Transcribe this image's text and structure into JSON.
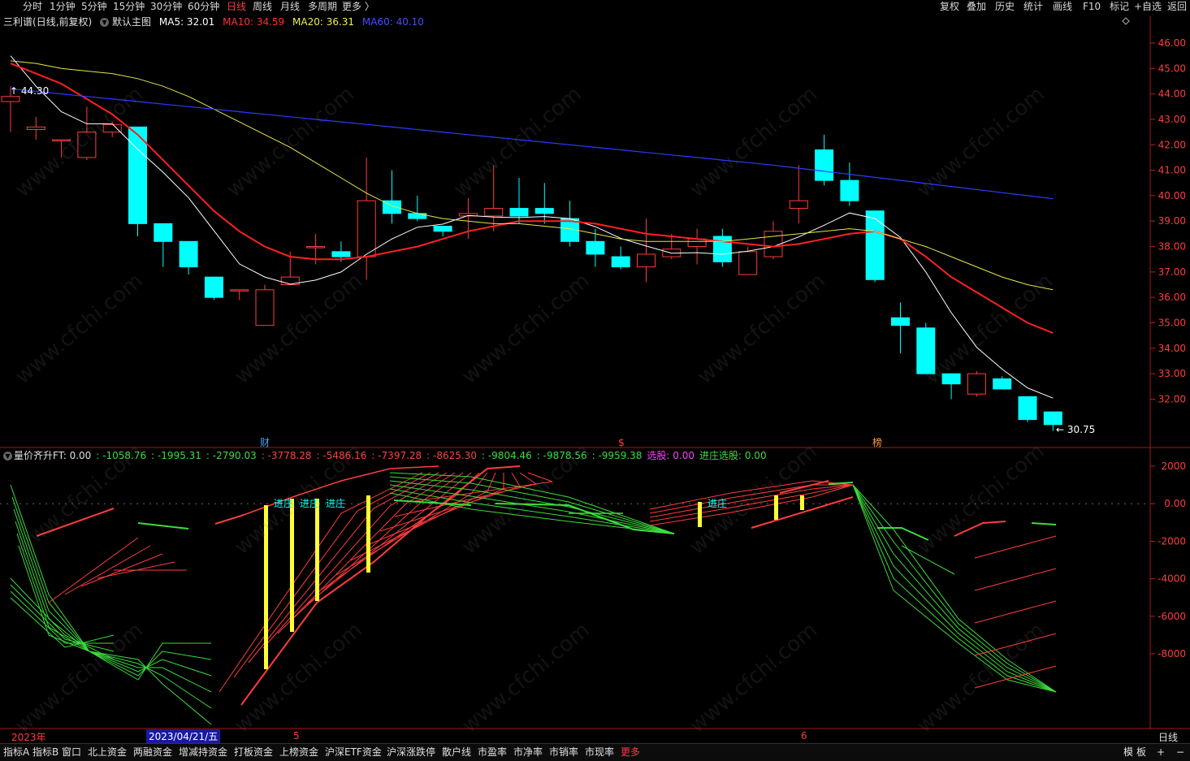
{
  "top_bar": {
    "timeframes": [
      "分时",
      "1分钟",
      "5分钟",
      "15分钟",
      "30分钟",
      "60分钟",
      "日线",
      "周线",
      "月线",
      "多周期",
      "更多 〉"
    ],
    "active_timeframe": "日线",
    "right_buttons": [
      "复权",
      "叠加",
      "历史",
      "统计",
      "画线",
      "F10",
      "标记",
      "+自选",
      "返回"
    ]
  },
  "main_chart": {
    "stock_name": "三利谱",
    "mode": "(日线,前复权)",
    "template": "默认主图",
    "ma5": "MA5: 32.01",
    "ma10": "MA10: 34.59",
    "ma20": "MA20: 36.31",
    "ma60": "MA60: 40.10",
    "high_label": "44.30",
    "low_label": "30.75",
    "y_ticks": [
      "46.00",
      "45.00",
      "44.00",
      "43.00",
      "42.00",
      "41.00",
      "40.00",
      "39.00",
      "38.00",
      "37.00",
      "36.00",
      "35.00",
      "34.00",
      "33.00",
      "32.00"
    ],
    "event_markers": [
      "财",
      "$",
      "榜"
    ]
  },
  "indicator": {
    "name": "量价齐升FT",
    "values": [
      ": 0.00",
      ": -1058.76",
      ": -1995.31",
      ": -2790.03",
      ": -3778.28",
      ": -5486.16",
      ": -7397.28",
      ": -8625.30",
      ": -9804.46",
      ": -9878.56",
      ": -9959.38"
    ],
    "select_label": "选股: 0.00",
    "enter_select_label": "进庄选股: 0.00",
    "signal_text": "进庄",
    "y_ticks": [
      "2000",
      "0.00",
      "-2000",
      "-4000",
      "-6000",
      "-8000"
    ]
  },
  "date_bar": {
    "year": "2023年",
    "cursor_date": "2023/04/21/五",
    "month5": "5",
    "month6": "6",
    "period": "日线"
  },
  "bottom_tabs": [
    "指标A",
    "指标B",
    "窗口",
    "北上资金",
    "两融资金",
    "增减持资金",
    "打板资金",
    "上榜资金",
    "沪深ETF资金",
    "沪深涨跌停",
    "散户线",
    "市盈率",
    "市净率",
    "市销率",
    "市现率",
    "更多"
  ],
  "bottom_right": [
    "模",
    "板",
    "+",
    "−"
  ],
  "watermark": "www.cfchi.com",
  "colors": {
    "up": "#ff3c3c",
    "down": "#00ffff",
    "ma5": "#ffffff",
    "ma10": "#ff2020",
    "ma20": "#e6e64d",
    "ma60": "#2a3cff",
    "green": "#3cdc3c",
    "yellow": "#ffff33"
  },
  "chart_data": {
    "type": "candlestick",
    "price_axis": {
      "min": 30.5,
      "max": 46.3
    },
    "candles": [
      [
        43.7,
        43.9,
        42.5,
        44.3
      ],
      [
        42.6,
        42.7,
        42.2,
        43.1
      ],
      [
        42.2,
        42.2,
        41.5,
        42.2
      ],
      [
        41.5,
        42.5,
        41.4,
        43.5
      ],
      [
        42.5,
        42.8,
        42.3,
        42.9
      ],
      [
        42.7,
        38.9,
        38.4,
        42.7
      ],
      [
        38.9,
        38.2,
        37.2,
        38.9
      ],
      [
        38.2,
        37.2,
        36.9,
        38.2
      ],
      [
        36.8,
        36.0,
        35.9,
        36.8
      ],
      [
        36.3,
        36.3,
        35.9,
        36.3
      ],
      [
        34.9,
        36.3,
        34.9,
        36.5
      ],
      [
        36.5,
        36.8,
        36.5,
        37.8
      ],
      [
        38.0,
        38.0,
        37.3,
        38.5
      ],
      [
        37.8,
        37.6,
        37.4,
        38.2
      ],
      [
        37.6,
        39.8,
        36.7,
        41.5
      ],
      [
        39.8,
        39.3,
        38.9,
        41.0
      ],
      [
        39.3,
        39.1,
        39.0,
        40.0
      ],
      [
        38.8,
        38.6,
        38.4,
        38.8
      ],
      [
        39.2,
        39.3,
        38.3,
        39.9
      ],
      [
        39.2,
        39.5,
        38.6,
        41.2
      ],
      [
        39.5,
        39.2,
        38.9,
        40.7
      ],
      [
        39.5,
        39.3,
        38.9,
        40.5
      ],
      [
        39.1,
        38.2,
        38.0,
        39.8
      ],
      [
        38.2,
        37.7,
        37.2,
        38.7
      ],
      [
        37.6,
        37.2,
        37.1,
        38.0
      ],
      [
        37.2,
        37.7,
        36.6,
        39.1
      ],
      [
        37.6,
        37.9,
        37.5,
        38.5
      ],
      [
        38.0,
        38.3,
        37.3,
        38.7
      ],
      [
        38.4,
        37.4,
        37.2,
        38.7
      ],
      [
        36.9,
        37.8,
        36.9,
        38.0
      ],
      [
        37.6,
        38.6,
        37.5,
        39.0
      ],
      [
        39.5,
        39.8,
        38.9,
        41.2
      ],
      [
        41.8,
        40.6,
        40.4,
        42.4
      ],
      [
        40.6,
        39.8,
        39.6,
        41.3
      ],
      [
        39.4,
        36.7,
        36.6,
        39.4
      ],
      [
        35.2,
        34.9,
        33.8,
        35.8
      ],
      [
        34.8,
        33.0,
        33.0,
        35.0
      ],
      [
        33.0,
        32.6,
        32.0,
        33.0
      ],
      [
        32.2,
        33.0,
        32.1,
        33.1
      ],
      [
        32.8,
        32.4,
        32.4,
        32.9
      ],
      [
        32.1,
        31.2,
        31.1,
        32.1
      ],
      [
        31.5,
        31.0,
        30.75,
        31.5
      ]
    ]
  }
}
